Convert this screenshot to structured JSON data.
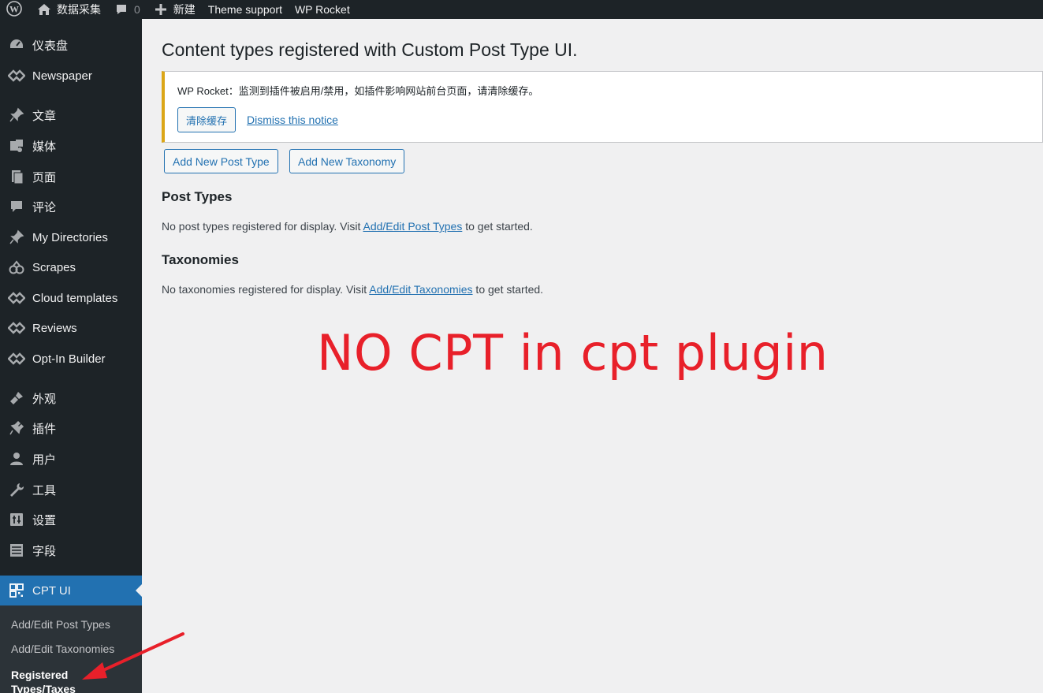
{
  "adminbar": {
    "site_name": "数据采集",
    "comments_count": "0",
    "new_label": "新建",
    "theme_support": "Theme support",
    "wp_rocket": "WP Rocket"
  },
  "sidebar": {
    "items": [
      {
        "label": "仪表盘",
        "icon": "dashboard-icon"
      },
      {
        "label": "Newspaper",
        "icon": "newspaper-icon"
      },
      {
        "label": "文章",
        "icon": "pin-icon"
      },
      {
        "label": "媒体",
        "icon": "media-icon"
      },
      {
        "label": "页面",
        "icon": "page-icon"
      },
      {
        "label": "评论",
        "icon": "comment-icon"
      },
      {
        "label": "My Directories",
        "icon": "pin-icon"
      },
      {
        "label": "Scrapes",
        "icon": "scrapes-icon"
      },
      {
        "label": "Cloud templates",
        "icon": "newspaper-icon"
      },
      {
        "label": "Reviews",
        "icon": "newspaper-icon"
      },
      {
        "label": "Opt-In Builder",
        "icon": "newspaper-icon"
      },
      {
        "label": "外观",
        "icon": "brush-icon"
      },
      {
        "label": "插件",
        "icon": "plugin-icon"
      },
      {
        "label": "用户",
        "icon": "user-icon"
      },
      {
        "label": "工具",
        "icon": "wrench-icon"
      },
      {
        "label": "设置",
        "icon": "settings-icon"
      },
      {
        "label": "字段",
        "icon": "fields-icon"
      },
      {
        "label": "CPT UI",
        "icon": "cpt-icon"
      }
    ],
    "submenu": [
      {
        "label": "Add/Edit Post Types"
      },
      {
        "label": "Add/Edit Taxonomies"
      },
      {
        "label": "Registered Types/Taxes"
      }
    ]
  },
  "main": {
    "title": "Content types registered with Custom Post Type UI.",
    "notice": {
      "prefix": "WP Rocket",
      "text": "：监测到插件被启用/禁用，如插件影响网站前台页面，请清除缓存。",
      "clear_button": "清除缓存",
      "dismiss": "Dismiss this notice"
    },
    "buttons": {
      "add_post_type": "Add New Post Type",
      "add_taxonomy": "Add New Taxonomy"
    },
    "post_types": {
      "heading": "Post Types",
      "text_before": "No post types registered for display. Visit ",
      "link": "Add/Edit Post Types",
      "text_after": " to get started."
    },
    "taxonomies": {
      "heading": "Taxonomies",
      "text_before": "No taxonomies registered for display. Visit ",
      "link": "Add/Edit Taxonomies",
      "text_after": " to get started."
    },
    "annotation": "NO CPT in cpt plugin"
  },
  "colors": {
    "admin_bg": "#1d2327",
    "accent": "#2271b1",
    "notice_border": "#dba617",
    "annotation": "#e8202a"
  }
}
